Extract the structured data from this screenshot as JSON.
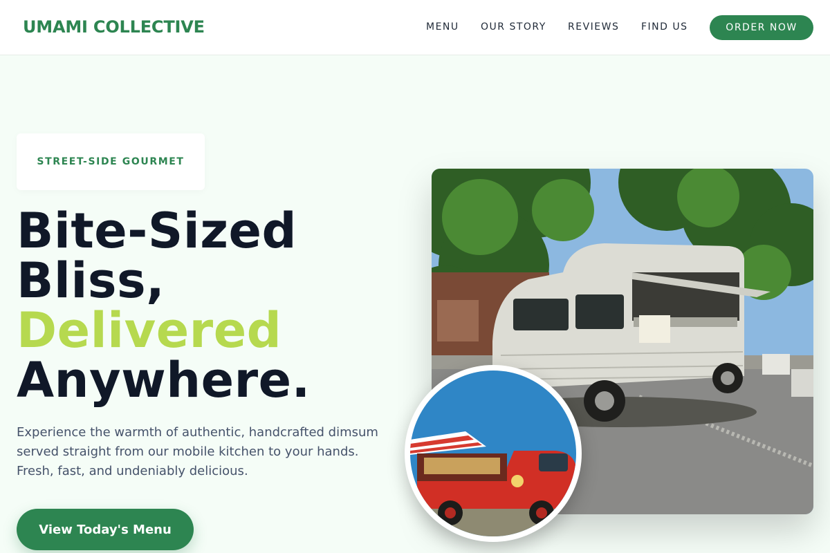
{
  "brand": "UMAMI COLLECTIVE",
  "nav": {
    "links": [
      "MENU",
      "OUR STORY",
      "REVIEWS",
      "FIND US"
    ],
    "order_label": "ORDER NOW"
  },
  "hero": {
    "tag": "STREET-SIDE GOURMET",
    "headline": {
      "line1": "Bite-Sized",
      "line2": "Bliss,",
      "accent": "Delivered",
      "line4": "Anywhere."
    },
    "description": "Experience the warmth of authentic, handcrafted dimsum served straight from our mobile kitchen to your hands. Fresh, fast, and undeniably delicious.",
    "cta_label": "View Today's Menu"
  },
  "colors": {
    "brand_green": "#2d8551",
    "accent_lime": "#b6d94f",
    "headline_dark": "#101828",
    "background": "#f5fdf7"
  },
  "images": {
    "main": "white-vintage-food-truck-photo",
    "inset": "red-vintage-food-van-photo"
  }
}
